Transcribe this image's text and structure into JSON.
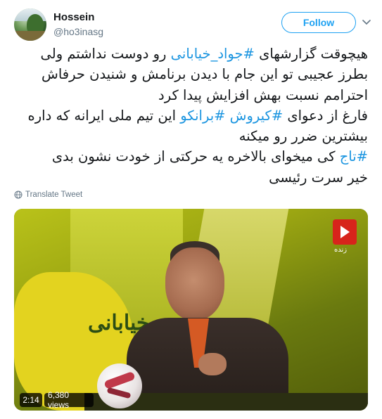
{
  "header": {
    "name": "Hossein",
    "handle": "@ho3inasg",
    "follow_label": "Follow",
    "menu_icon": "chevron-down-icon"
  },
  "tweet": {
    "lines": [
      [
        {
          "text": "هیچوقت گزارشهای ",
          "hashtag": false
        },
        {
          "text": "#جواد_خیابانی",
          "hashtag": true
        },
        {
          "text": " رو دوست نداشتم ولی",
          "hashtag": false
        }
      ],
      [
        {
          "text": "بطرز عجیبی تو این جام با دیدن برنامش و شنیدن حرفاش",
          "hashtag": false
        }
      ],
      [
        {
          "text": "احترامم نسبت بهش افزایش پیدا کرد",
          "hashtag": false
        }
      ],
      [
        {
          "text": "فارغ از دعوای ",
          "hashtag": false
        },
        {
          "text": "#کیروش",
          "hashtag": true
        },
        {
          "text": " ",
          "hashtag": false
        },
        {
          "text": "#برانکو",
          "hashtag": true
        },
        {
          "text": " این تیم ملی ایرانه که داره",
          "hashtag": false
        }
      ],
      [
        {
          "text": "بیشترین ضرر رو میکنه",
          "hashtag": false
        }
      ],
      [
        {
          "text": "#تاج",
          "hashtag": true
        },
        {
          "text": " کی میخوای بالاخره یه حرکتی از خودت نشون بدی",
          "hashtag": false
        }
      ],
      [
        {
          "text": "خیر سرت رئیسی",
          "hashtag": false
        }
      ]
    ],
    "hashtag_color": "#1b95e0",
    "translate_label": "Translate Tweet",
    "translate_icon": "globe-icon"
  },
  "media": {
    "duration": "2:14",
    "views": "6,380 views",
    "channel_logo_text": "زنده",
    "studio_sign_text": "خیابانی"
  },
  "colors": {
    "accent": "#1da1f2",
    "secondary_text": "#657786",
    "primary_text": "#14171a"
  }
}
